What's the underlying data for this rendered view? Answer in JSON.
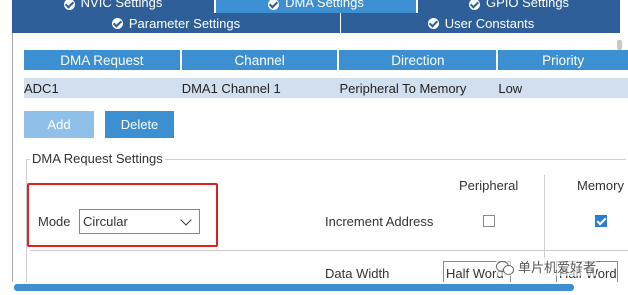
{
  "tabs": {
    "row1": [
      {
        "label": "NVIC Settings"
      },
      {
        "label": "DMA Settings"
      },
      {
        "label": "GPIO Settings"
      }
    ],
    "row2": [
      {
        "label": "Parameter Settings"
      },
      {
        "label": "User Constants"
      }
    ]
  },
  "table": {
    "headers": [
      "DMA Request",
      "Channel",
      "Direction",
      "Priority"
    ],
    "rows": [
      [
        "ADC1",
        "DMA1 Channel 1",
        "Peripheral To Memory",
        "Low"
      ]
    ]
  },
  "buttons": {
    "add": "Add",
    "delete": "Delete"
  },
  "settings": {
    "legend": "DMA Request Settings",
    "col_peripheral": "Peripheral",
    "col_memory": "Memory",
    "mode_label": "Mode",
    "mode_value": "Circular",
    "increment_label": "Increment Address",
    "increment_peripheral": false,
    "increment_memory": true,
    "data_width_label": "Data Width",
    "data_width_peripheral": "Half Word",
    "data_width_memory": "Half Word"
  },
  "watermark": {
    "text": "单片机爱好者"
  },
  "colors": {
    "accent": "#3c8fd0",
    "tab_dark": "#2e5f98",
    "row_bg": "#d2dfef",
    "highlight": "#e02020"
  }
}
